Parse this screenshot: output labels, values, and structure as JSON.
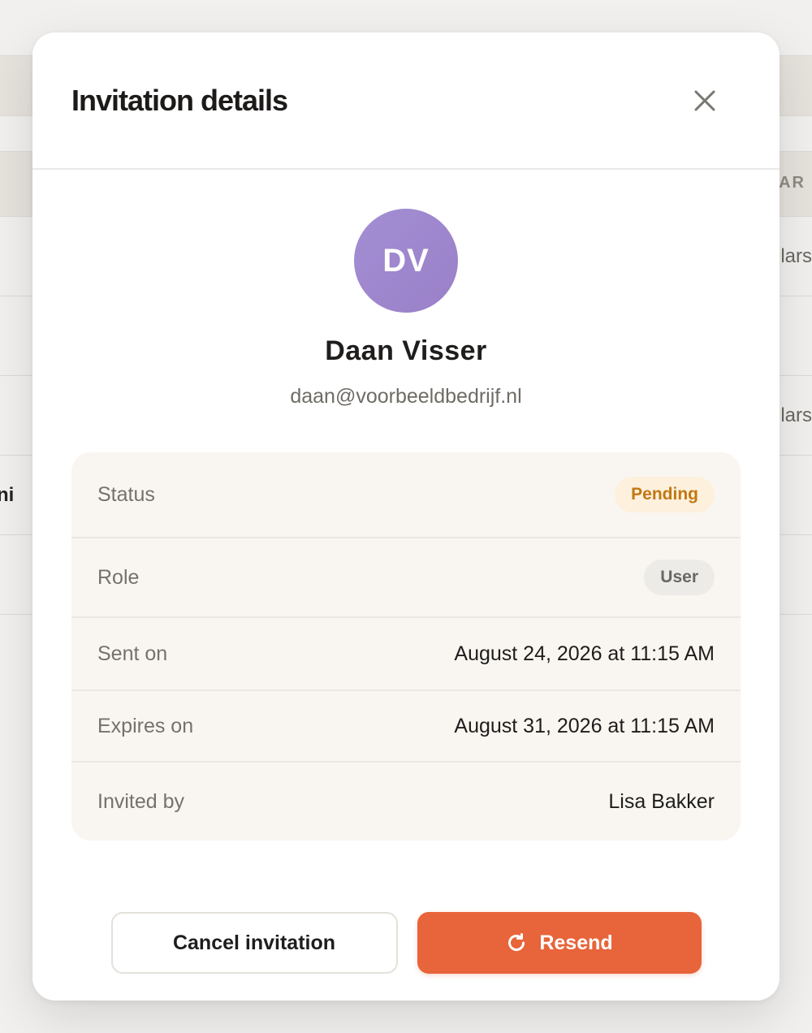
{
  "background": {
    "column_header": "AR",
    "cell_1": "lars",
    "cell_2": "lars",
    "left_cell": "ni"
  },
  "modal": {
    "title": "Invitation details",
    "close_icon": "close-icon"
  },
  "invitee": {
    "initials": "DV",
    "name": "Daan Visser",
    "email": "daan@voorbeeldbedrijf.nl",
    "avatar_color": "#a08bd1"
  },
  "details": {
    "status_label": "Status",
    "status_value": "Pending",
    "role_label": "Role",
    "role_value": "User",
    "sent_label": "Sent on",
    "sent_value": "August 24, 2026 at 11:15 AM",
    "expires_label": "Expires on",
    "expires_value": "August 31, 2026 at 11:15 AM",
    "invited_by_label": "Invited by",
    "invited_by_value": "Lisa Bakker"
  },
  "actions": {
    "cancel_label": "Cancel invitation",
    "resend_label": "Resend",
    "resend_icon": "refresh-icon",
    "accent_color": "#e8643a"
  }
}
